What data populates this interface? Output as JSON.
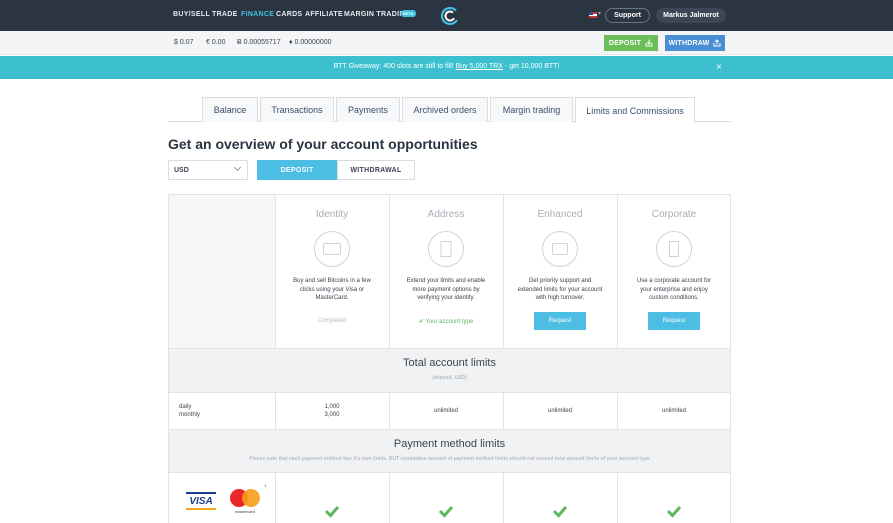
{
  "nav": {
    "items": [
      "BUY/SELL",
      "TRADE",
      "FINANCE",
      "CARDS",
      "AFFILIATE",
      "MARGIN TRADING"
    ],
    "active": "FINANCE",
    "beta_badge": "BETA",
    "support_label": "Support",
    "user_name": "Markus Jalmerot"
  },
  "balances": [
    {
      "icon": "dollar",
      "text": "$ 0.07"
    },
    {
      "icon": "euro",
      "text": "€ 0.00"
    },
    {
      "icon": "bitcoin",
      "text": "Ƀ 0.00055717"
    },
    {
      "icon": "ethereum",
      "text": "♦ 0.00000000"
    }
  ],
  "actions": {
    "deposit": "DEPOSIT",
    "withdraw": "WITHDRAW"
  },
  "announcement": {
    "text_before": "BTT Giveaway: 400 slots are still to fill! ",
    "link": "Buy 5,000 TRX",
    "text_after": " - get 10,000 BTT!",
    "close": "×"
  },
  "tabs": [
    "Balance",
    "Transactions",
    "Payments",
    "Archived orders",
    "Margin trading",
    "Limits and Commissions"
  ],
  "active_tab": "Limits and Commissions",
  "heading": "Get an overview of your account opportunities",
  "currency_select": "USD",
  "segment": {
    "deposit": "DEPOSIT",
    "withdrawal": "WITHDRAWAL",
    "selected": "DEPOSIT"
  },
  "tiers": [
    {
      "name": "Identity",
      "icon": "id-card-icon",
      "desc": "Buy and sell Bitcoins in a few clicks using your Visa or MasterCard.",
      "status": "Completed"
    },
    {
      "name": "Address",
      "icon": "document-icon",
      "desc": "Extend your limits and enable more payment options by verifying your identity.",
      "status": "✔ Your account type"
    },
    {
      "name": "Enhanced",
      "icon": "camera-icon",
      "desc": "Get priority support and extended limits for your account with high turnover.",
      "button": "Request"
    },
    {
      "name": "Corporate",
      "icon": "building-icon",
      "desc": "Use a corporate account for your enterprise and enjoy custom conditions.",
      "button": "Request"
    }
  ],
  "total_limits": {
    "title": "Total account limits",
    "subtitle": "(deposit, USD)",
    "row_labels": [
      "daily",
      "monthly"
    ],
    "identity": [
      "1,000",
      "3,000"
    ],
    "address": "unlimited",
    "enhanced": "unlimited",
    "corporate": "unlimited"
  },
  "payment_limits": {
    "title": "Payment method limits",
    "note": "Please note that each payment method has it's own limits, BUT cumulative amount of payment method limits should not exceed total amount limits of your account type",
    "visa_label": "VISA",
    "mastercard_label": "mastercard",
    "footnote": "1"
  },
  "colors": {
    "nav_bg": "#2b3441",
    "accent": "#3fc0e2",
    "deposit_green": "#6bbf5a",
    "withdraw_blue": "#4a8fd3",
    "banner": "#3cc0cf",
    "check_green": "#5cb85c"
  }
}
